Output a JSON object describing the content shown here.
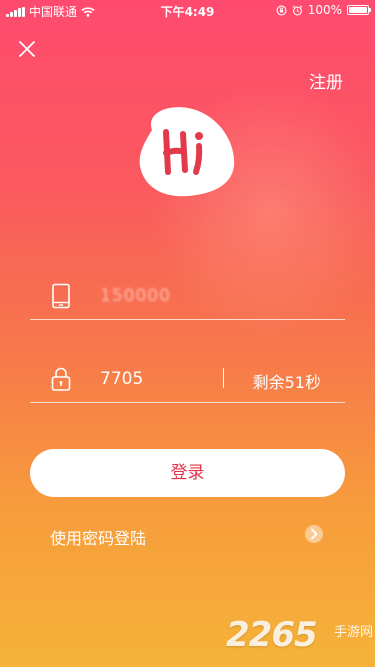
{
  "status_bar": {
    "carrier": "中国联通",
    "time": "下午4:49",
    "battery": "100%",
    "battery_level": 1.0
  },
  "header": {
    "register_label": "注册"
  },
  "logo": {
    "text": "Hi"
  },
  "phone_field": {
    "value": "150000"
  },
  "code_field": {
    "value": "7705",
    "countdown": "剩余51秒"
  },
  "login_button": {
    "label": "登录"
  },
  "password_login": {
    "label": "使用密码登陆"
  },
  "watermark": {
    "number": "2265",
    "sub": "手游网"
  },
  "colors": {
    "gradient_top": "#ff4a6f",
    "gradient_bottom": "#f5b338",
    "login_text": "#e5334a",
    "logo_red": "#e33a4b"
  },
  "icons": {
    "close": "close-icon",
    "phone": "phone-icon",
    "lock": "lock-icon",
    "arrow": "chevron-right-circle-icon",
    "wifi": "wifi-icon",
    "alarm": "alarm-icon",
    "rotation_lock": "rotation-lock-icon"
  }
}
